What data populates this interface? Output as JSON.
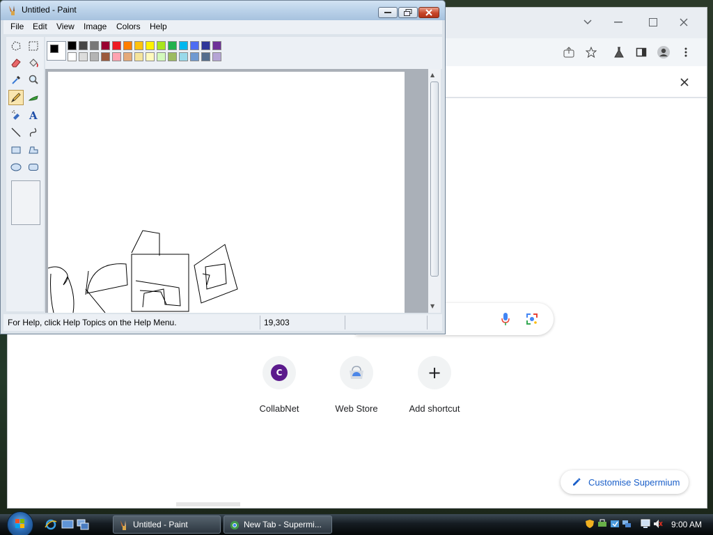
{
  "browser": {
    "window_controls": {
      "dropdown": "⌄",
      "minimize": "—",
      "maximize": "☐",
      "close": "✕"
    },
    "searchbox": {
      "mic_icon": "mic-icon",
      "lens_icon": "lens-icon"
    },
    "shortcuts": [
      {
        "label": "CollabNet",
        "badge": "C"
      },
      {
        "label": "Web Store"
      },
      {
        "label": "Add shortcut",
        "glyph": "+"
      }
    ],
    "customise_label": "Customise Supermium"
  },
  "paint": {
    "title": "Untitled - Paint",
    "menu": [
      "File",
      "Edit",
      "View",
      "Image",
      "Colors",
      "Help"
    ],
    "status_message": "For Help, click Help Topics on the Help Menu.",
    "status_coords": "19,303",
    "palette_top": [
      "#000000",
      "#464646",
      "#787878",
      "#990030",
      "#ed1c24",
      "#ff7e00",
      "#ffc20e",
      "#fff200",
      "#a8e61d",
      "#22b14c",
      "#00b7ef",
      "#4d6df3",
      "#2f3699",
      "#6f3198"
    ],
    "palette_bottom": [
      "#ffffff",
      "#dcdcdc",
      "#b4b4b4",
      "#9c5a3c",
      "#ffa3b1",
      "#e5aa7a",
      "#f5e49c",
      "#fff9bd",
      "#d3f9bc",
      "#9dbb61",
      "#99d9ea",
      "#709ad1",
      "#546d8e",
      "#b5a5d5"
    ],
    "tools": [
      "free-select",
      "rect-select",
      "eraser",
      "fill",
      "color-picker",
      "magnifier",
      "pencil",
      "brush",
      "airbrush",
      "text",
      "line",
      "curve",
      "rectangle",
      "polygon",
      "ellipse",
      "rounded-rectangle"
    ],
    "active_tool": "pencil"
  },
  "taskbar": {
    "tasks": [
      {
        "label": "Untitled - Paint"
      },
      {
        "label": "New Tab - Supermi..."
      }
    ],
    "clock": "9:00 AM"
  }
}
